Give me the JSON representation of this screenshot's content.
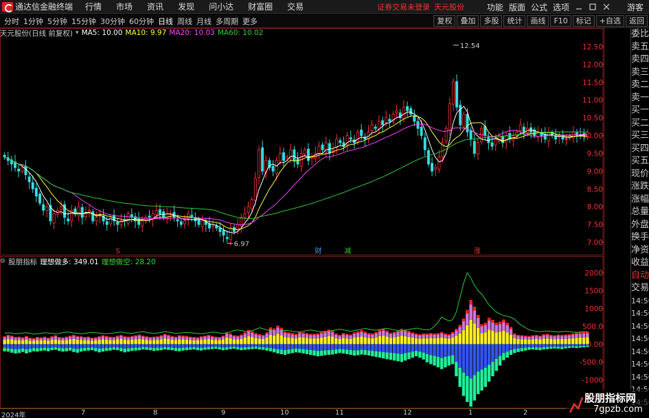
{
  "menubar": {
    "app_title": "通达信金融终端",
    "menus": [
      "行情",
      "市场",
      "资讯",
      "发现",
      "问小达",
      "财富圈",
      "交易"
    ],
    "warning": "证券交易未登录",
    "account": "天元股份",
    "right_menus": [
      "功能",
      "版面",
      "公式",
      "选项"
    ],
    "guest": "游客"
  },
  "periodbar": {
    "periods": [
      "分时",
      "1分钟",
      "5分钟",
      "15分钟",
      "30分钟",
      "60分钟",
      "日线",
      "周线",
      "月线",
      "多周期",
      "更多"
    ],
    "active": "日线",
    "tools": [
      "复权",
      "叠加",
      "多股",
      "统计",
      "画线",
      "F10",
      "标记",
      "+自选",
      "返回"
    ]
  },
  "main_info": {
    "title": "天元股份(日线 前复权)",
    "ma5": "MA5: 10.00",
    "ma10": "MA10: 9.97",
    "ma20": "MA20: 10.03",
    "ma60": "MA60: 10.02"
  },
  "sub_info": {
    "title": "股朋指标",
    "long": "理想做多: 349.01",
    "short": "理想做空: 28.20"
  },
  "price_axis": [
    "12.50",
    "12.00",
    "11.50",
    "11.00",
    "10.50",
    "10.00",
    "9.50",
    "9.00",
    "8.50",
    "8.00",
    "7.50",
    "7.00"
  ],
  "price_annotations": {
    "high": "12.54",
    "low": "6.97"
  },
  "event_tags": [
    "S",
    "财",
    "减",
    "涨"
  ],
  "sub_axis": [
    "2000",
    "1500",
    "1000",
    "500.0",
    "0.00",
    "-500.0",
    "-1000",
    "-1500"
  ],
  "side_panel": [
    "委比",
    "卖五",
    "卖四",
    "卖三",
    "卖二",
    "卖一",
    "买一",
    "买二",
    "买三",
    "买四",
    "买五",
    "现价",
    "涨跌",
    "涨幅",
    "总量",
    "外盘",
    "换手",
    "净资",
    "收益",
    "自动",
    "交易",
    "14:56",
    "14:56",
    "14:56",
    "14:56",
    "14:56",
    "14:56",
    "14:56",
    "14:56",
    "14:56"
  ],
  "date_axis": [
    "2024年",
    "7",
    "8",
    "9",
    "10",
    "11",
    "12",
    "1",
    "2"
  ],
  "watermark": {
    "line1": "股朋指标网",
    "line2": "7gpzb.com"
  },
  "colors": {
    "up": "#ff3333",
    "down": "#33dddd",
    "ma5": "#ffffff",
    "ma10": "#ffff44",
    "ma20": "#ff44ff",
    "ma60": "#33cc33",
    "grid": "#7a1a1a"
  },
  "chart_data": [
    {
      "type": "candlestick",
      "title": "天元股份(日线 前复权)",
      "ylim": [
        6.75,
        12.75
      ],
      "y_ticks": [
        12.5,
        12.0,
        11.5,
        11.0,
        10.5,
        10.0,
        9.5,
        9.0,
        8.5,
        8.0,
        7.5,
        7.0
      ],
      "x_labels": [
        "2024年",
        "7",
        "8",
        "9",
        "10",
        "11",
        "12",
        "1",
        "2"
      ],
      "annotations": [
        {
          "label": "12.54",
          "value": 12.54
        },
        {
          "label": "6.97",
          "value": 6.97
        }
      ],
      "close": [
        9.4,
        9.3,
        9.2,
        9.1,
        9.0,
        9.1,
        8.9,
        8.7,
        8.5,
        8.3,
        8.1,
        7.9,
        8.0,
        7.6,
        7.8,
        7.9,
        8.0,
        7.7,
        7.6,
        7.9,
        7.8,
        8.0,
        7.7,
        7.8,
        7.9,
        7.6,
        7.7,
        7.8,
        7.6,
        7.5,
        7.7,
        7.6,
        7.5,
        7.6,
        7.6,
        7.8,
        7.7,
        7.6,
        7.5,
        7.6,
        7.7,
        7.7,
        7.8,
        7.9,
        7.8,
        7.7,
        7.8,
        7.8,
        7.7,
        7.6,
        7.5,
        7.6,
        7.8,
        7.7,
        7.6,
        7.5,
        7.6,
        7.5,
        7.4,
        7.5,
        7.4,
        7.3,
        7.2,
        7.1,
        7.4,
        7.3,
        7.5,
        7.7,
        7.8,
        8.0,
        8.2,
        8.8,
        9.6,
        9.0,
        9.3,
        9.1,
        9.0,
        9.3,
        9.5,
        9.3,
        9.4,
        9.6,
        9.3,
        9.2,
        9.5,
        9.6,
        9.3,
        9.4,
        9.5,
        9.7,
        9.6,
        9.8,
        9.5,
        9.6,
        9.9,
        9.8,
        9.7,
        10.0,
        9.9,
        9.8,
        10.1,
        10.0,
        9.9,
        10.1,
        10.3,
        10.2,
        10.4,
        10.3,
        10.5,
        10.4,
        10.6,
        10.7,
        10.5,
        10.8,
        10.7,
        10.6,
        10.4,
        10.2,
        10.0,
        9.6,
        9.2,
        9.0,
        9.1,
        9.4,
        9.8,
        10.2,
        10.9,
        11.5,
        10.8,
        10.3,
        10.6,
        10.1,
        9.9,
        9.5,
        9.8,
        10.2,
        10.0,
        9.8,
        9.7,
        9.9,
        10.0,
        9.8,
        10.0,
        9.9,
        10.0,
        10.1,
        10.3,
        10.1,
        10.2,
        10.1,
        10.0,
        10.1,
        10.0,
        9.9,
        10.1,
        10.0,
        9.9,
        10.0,
        9.9,
        9.9,
        10.0,
        10.1,
        10.0,
        10.0,
        10.0,
        10.1
      ],
      "ma5": 10.0,
      "ma10": 9.97,
      "ma20": 10.03,
      "ma60": 10.02
    },
    {
      "type": "bar",
      "title": "股朋指标",
      "series": [
        {
          "name": "理想做多",
          "last": 349.01
        },
        {
          "name": "理想做空",
          "last": 28.2
        }
      ],
      "ylim": [
        -1800,
        2200
      ],
      "y_ticks": [
        2000,
        1500,
        1000,
        500,
        0,
        -500,
        -1000,
        -1500
      ],
      "pos": [
        220,
        260,
        240,
        200,
        210,
        190,
        230,
        180,
        170,
        200,
        190,
        210,
        180,
        220,
        250,
        200,
        190,
        210,
        240,
        260,
        230,
        220,
        200,
        210,
        180,
        190,
        220,
        250,
        230,
        210,
        200,
        240,
        260,
        220,
        210,
        230,
        250,
        270,
        240,
        220,
        200,
        210,
        220,
        250,
        290,
        260,
        230,
        210,
        250,
        240,
        230,
        210,
        200,
        190,
        220,
        240,
        260,
        230,
        210,
        200,
        240,
        330,
        300,
        250,
        240,
        270,
        330,
        400,
        360,
        310,
        280,
        260,
        330,
        470,
        440,
        520,
        460,
        360,
        330,
        310,
        290,
        350,
        330,
        310,
        290,
        290,
        300,
        340,
        370,
        410,
        380,
        300,
        260,
        310,
        290,
        270,
        330,
        360,
        390,
        350,
        310,
        300,
        340,
        400,
        430,
        380,
        320,
        350,
        390,
        430,
        410,
        370,
        330,
        300,
        280,
        300,
        300,
        310,
        300,
        310,
        340,
        300,
        280,
        340,
        430,
        540,
        720,
        960,
        1240,
        1050,
        820,
        560,
        600,
        740,
        680,
        600,
        630,
        690,
        600,
        480,
        300,
        260,
        250,
        240,
        230,
        250,
        260,
        240,
        280,
        290,
        260,
        250,
        270,
        260,
        270,
        280,
        300,
        320,
        330,
        340,
        349
      ],
      "neg": [
        -200,
        -210,
        -240,
        -260,
        -250,
        -220,
        -260,
        -230,
        -200,
        -210,
        -190,
        -180,
        -200,
        -170,
        -160,
        -190,
        -210,
        -200,
        -180,
        -220,
        -240,
        -210,
        -190,
        -180,
        -170,
        -200,
        -230,
        -210,
        -190,
        -180,
        -160,
        -170,
        -200,
        -230,
        -210,
        -190,
        -180,
        -170,
        -150,
        -160,
        -170,
        -190,
        -180,
        -170,
        -150,
        -160,
        -170,
        -190,
        -200,
        -180,
        -170,
        -160,
        -150,
        -170,
        -180,
        -160,
        -150,
        -140,
        -130,
        -150,
        -170,
        -160,
        -140,
        -130,
        -150,
        -170,
        -160,
        -150,
        -140,
        -130,
        -150,
        -160,
        -180,
        -200,
        -230,
        -260,
        -280,
        -300,
        -270,
        -250,
        -230,
        -240,
        -260,
        -280,
        -300,
        -320,
        -340,
        -330,
        -310,
        -300,
        -290,
        -270,
        -250,
        -260,
        -280,
        -300,
        -320,
        -310,
        -290,
        -300,
        -320,
        -340,
        -360,
        -380,
        -400,
        -420,
        -440,
        -460,
        -480,
        -500,
        -460,
        -420,
        -380,
        -340,
        -380,
        -430,
        -510,
        -560,
        -600,
        -650,
        -700,
        -650,
        -600,
        -560,
        -900,
        -1200,
        -1450,
        -1620,
        -1750,
        -1580,
        -1400,
        -1300,
        -1200,
        -1050,
        -900,
        -750,
        -600,
        -450,
        -380,
        -300,
        -250,
        -220,
        -200,
        -180,
        -160,
        -150,
        -160,
        -170,
        -150,
        -140,
        -130,
        -120,
        -130,
        -140,
        -120,
        -110,
        -100,
        -110,
        -100,
        -90,
        -80,
        -28
      ],
      "line": [
        300,
        320,
        310,
        290,
        300,
        310,
        320,
        300,
        280,
        290,
        300,
        320,
        310,
        300,
        290,
        300,
        320,
        340,
        330,
        310,
        300,
        290,
        300,
        320,
        330,
        320,
        310,
        300,
        290,
        300,
        310,
        330,
        340,
        320,
        310,
        300,
        320,
        340,
        350,
        330,
        310,
        300,
        310,
        330,
        350,
        340,
        320,
        300,
        310,
        320,
        330,
        320,
        310,
        300,
        290,
        300,
        320,
        340,
        330,
        310,
        300,
        320,
        340,
        380,
        400,
        380,
        360,
        350,
        380,
        420,
        460,
        430,
        400,
        380,
        360,
        350,
        370,
        390,
        380,
        360,
        350,
        340,
        360,
        380,
        400,
        380,
        360,
        350,
        340,
        360,
        380,
        400,
        420,
        400,
        380,
        360,
        380,
        400,
        420,
        440,
        420,
        400,
        390,
        410,
        430,
        440,
        420,
        400,
        380,
        370,
        390,
        410,
        430,
        450,
        430,
        410,
        400,
        420,
        500,
        620,
        760,
        700,
        650,
        680,
        900,
        1300,
        1700,
        2000,
        1850,
        1650,
        1500,
        1400,
        1250,
        1100,
        1000,
        900,
        850,
        800,
        780,
        750,
        700,
        600,
        520,
        460,
        400,
        380,
        360,
        350,
        360,
        370,
        360,
        350,
        340,
        350,
        360,
        350,
        340,
        330,
        340,
        350,
        349
      ]
    }
  ]
}
